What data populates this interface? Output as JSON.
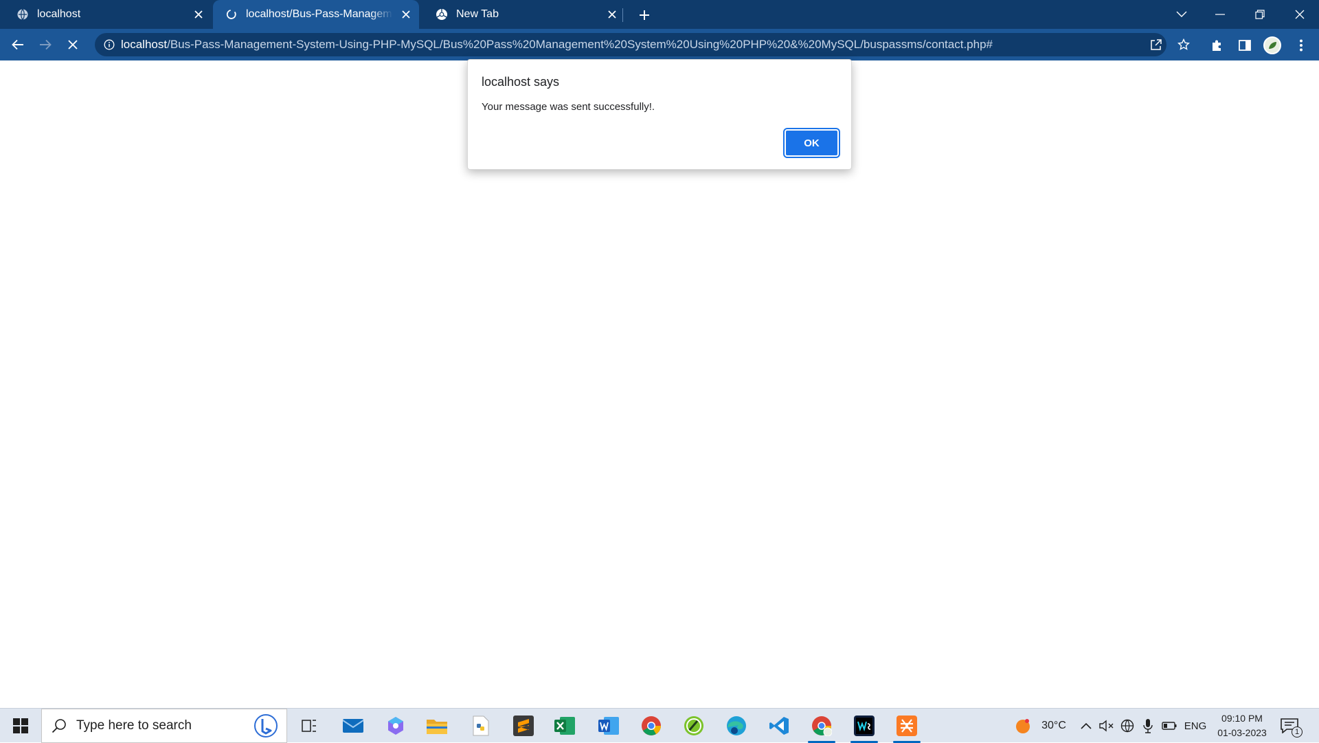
{
  "browser": {
    "tabs": [
      {
        "title": "localhost",
        "active": false
      },
      {
        "title": "localhost/Bus-Pass-Management-System",
        "active": true
      },
      {
        "title": "New Tab",
        "active": false
      }
    ],
    "url": {
      "host": "localhost",
      "path": "/Bus-Pass-Management-System-Using-PHP-MySQL/Bus%20Pass%20Management%20System%20Using%20PHP%20&%20MySQL/buspassms/contact.php#"
    },
    "loading": true
  },
  "dialog": {
    "title": "localhost says",
    "message": "Your message was sent successfully!.",
    "ok_label": "OK"
  },
  "taskbar": {
    "search_placeholder": "Type here to search",
    "apps": [
      "task-view",
      "mail",
      "copilot",
      "file-explorer",
      "python",
      "sublime-text",
      "excel",
      "word",
      "chrome",
      "android-studio",
      "edge",
      "vscode",
      "chrome-profile",
      "webstorm",
      "xampp"
    ],
    "weather": "30°C",
    "language": "ENG",
    "time": "09:10 PM",
    "date": "01-03-2023",
    "notification_count": "1"
  },
  "colors": {
    "tabstrip": "#0f3b6b",
    "toolbar": "#1c5797",
    "ok_button": "#1a73e8",
    "taskbar": "#dfe6f0"
  }
}
